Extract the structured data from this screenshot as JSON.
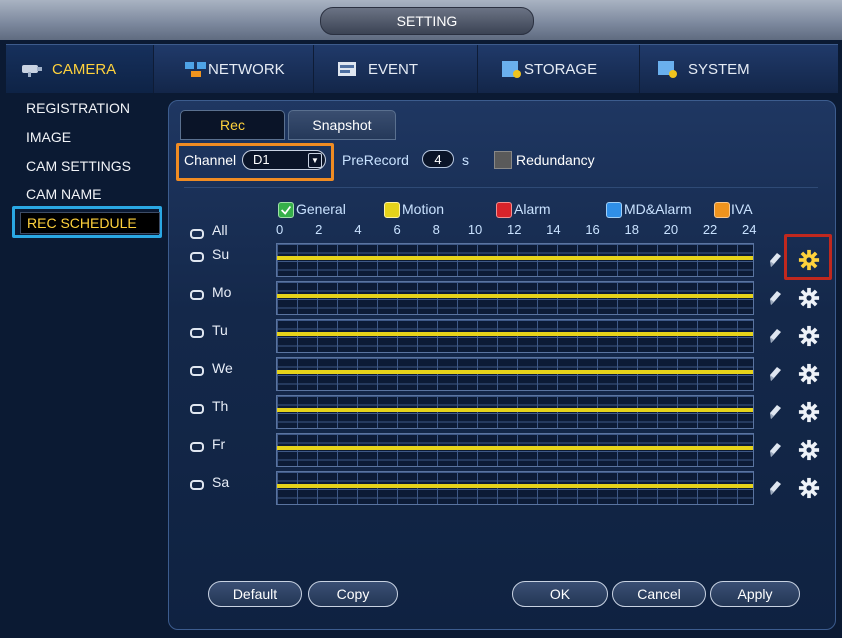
{
  "window": {
    "title": "SETTING"
  },
  "main_tabs": [
    {
      "label": "CAMERA",
      "icon": "camera-icon",
      "active": true
    },
    {
      "label": "NETWORK",
      "icon": "network-icon"
    },
    {
      "label": "EVENT",
      "icon": "event-icon"
    },
    {
      "label": "STORAGE",
      "icon": "storage-icon"
    },
    {
      "label": "SYSTEM",
      "icon": "system-icon"
    }
  ],
  "sidebar": {
    "items": [
      {
        "label": "REGISTRATION"
      },
      {
        "label": "IMAGE"
      },
      {
        "label": "CAM SETTINGS"
      },
      {
        "label": "CAM NAME"
      },
      {
        "label": "REC SCHEDULE",
        "active": true
      }
    ]
  },
  "subtabs": {
    "rec": "Rec",
    "snapshot": "Snapshot"
  },
  "controls": {
    "channel_label": "Channel",
    "channel_value": "D1",
    "prerecord_label": "PreRecord",
    "prerecord_value": "4",
    "prerecord_unit": "s",
    "redundancy_label": "Redundancy",
    "redundancy_checked": false
  },
  "legend": [
    {
      "label": "General",
      "color": "#36b04a",
      "checked": true
    },
    {
      "label": "Motion",
      "color": "#e6d31a"
    },
    {
      "label": "Alarm",
      "color": "#d8232a"
    },
    {
      "label": "MD&Alarm",
      "color": "#2f8fe8"
    },
    {
      "label": "IVA",
      "color": "#f0941e"
    }
  ],
  "schedule": {
    "all_label": "All",
    "hours": [
      "0",
      "2",
      "4",
      "6",
      "8",
      "10",
      "12",
      "14",
      "16",
      "18",
      "20",
      "22",
      "24"
    ],
    "days": [
      "Su",
      "Mo",
      "Tu",
      "We",
      "Th",
      "Fr",
      "Sa"
    ],
    "bar_color": "#e6d31a"
  },
  "buttons": {
    "default": "Default",
    "copy": "Copy",
    "ok": "OK",
    "cancel": "Cancel",
    "apply": "Apply"
  },
  "colors": {
    "accent_yellow": "#ffd23c",
    "highlight_orange": "#f08c23",
    "highlight_blue": "#2aa8e4",
    "highlight_red": "#c0281e"
  }
}
